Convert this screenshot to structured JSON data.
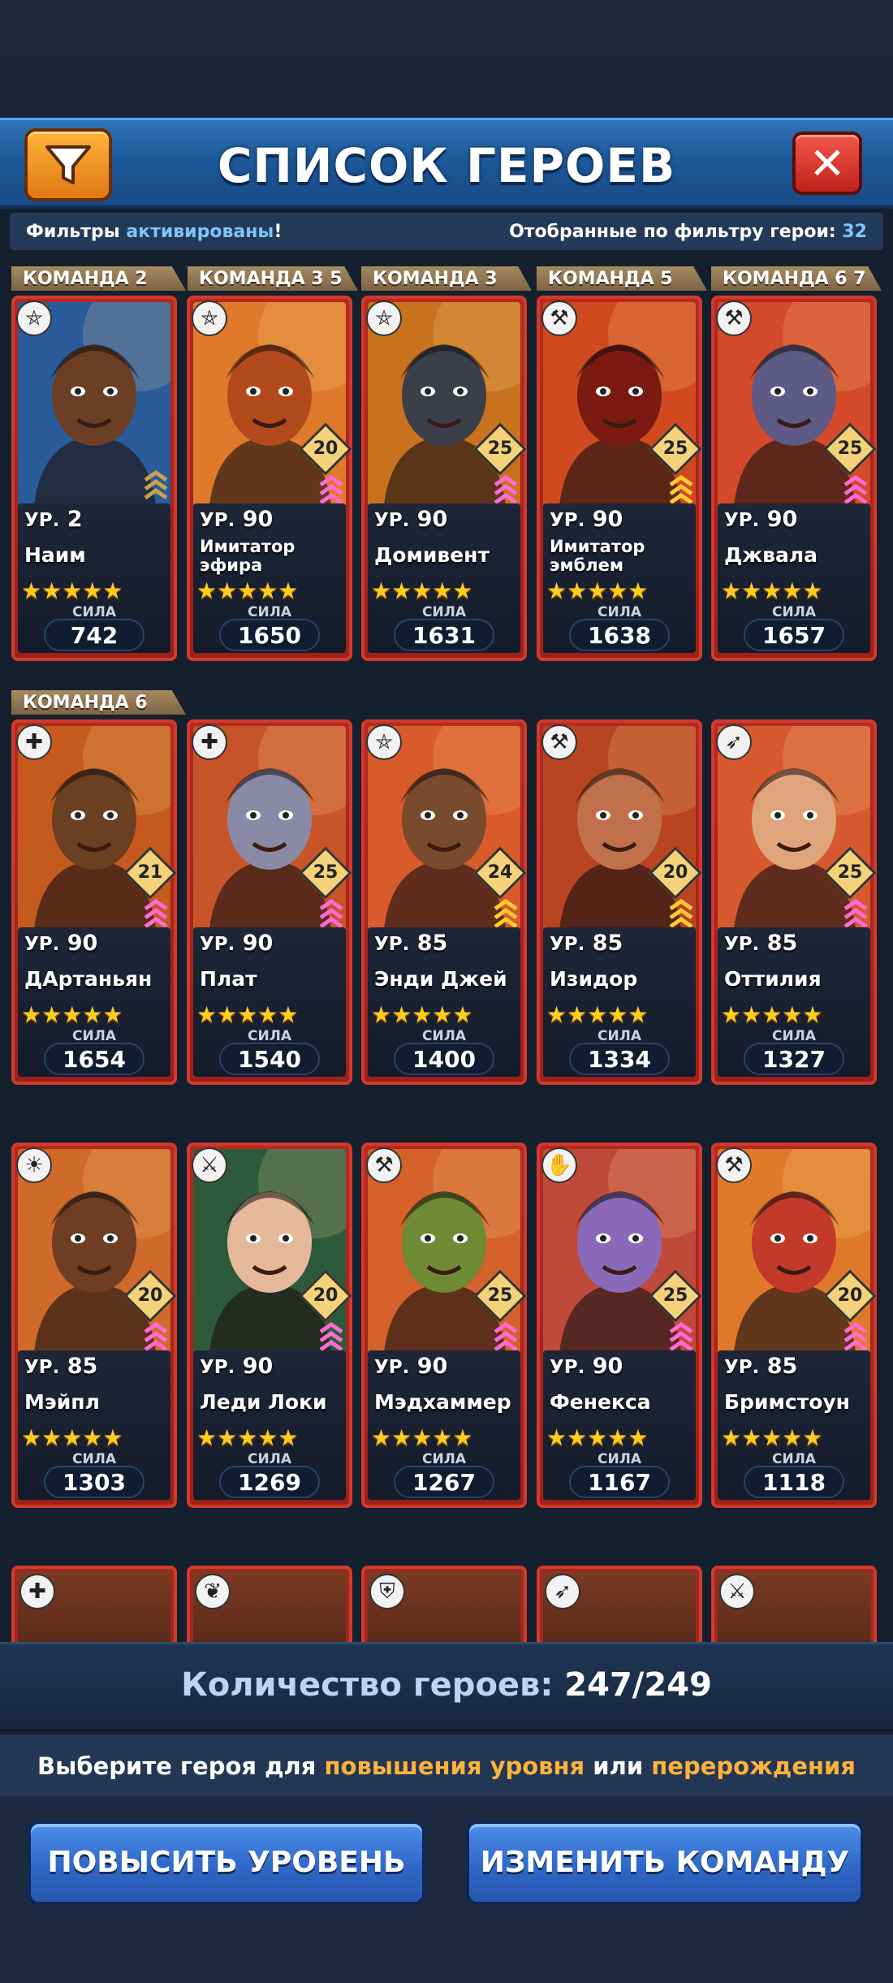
{
  "header": {
    "title": "СПИСОК ГЕРОЕВ",
    "filter_icon": "funnel-icon",
    "close_icon": "close-icon",
    "close_glyph": "✕"
  },
  "filter_bar": {
    "left_prefix": "Фильтры ",
    "left_highlight": "активированы",
    "left_suffix": "!",
    "right_label": "Отобранные по фильтру герои: ",
    "right_count": "32"
  },
  "level_prefix": "УР.",
  "power_label": "СИЛА",
  "stars": "★★★★★",
  "teams": [
    "КОМАНДА 2",
    "КОМАНДА 3 5",
    "КОМАНДА 3",
    "КОМАНДА 5",
    "КОМАНДА 6 7",
    "КОМАНДА 6"
  ],
  "heroes": [
    {
      "name": "Наим",
      "level": "2",
      "power": "742",
      "badge": "",
      "class": "wizard-hat-icon",
      "skin": "#6b3e26",
      "bg": "#2a5b9a",
      "chev": "#c8a24a"
    },
    {
      "name": "Имитатор эфира",
      "level": "90",
      "power": "1650",
      "badge": "20",
      "class": "pentagram-icon",
      "skin": "#b34a1c",
      "bg": "#e07a2a",
      "chev": "#ff6ad5"
    },
    {
      "name": "Домивент",
      "level": "90",
      "power": "1631",
      "badge": "25",
      "class": "pentagram-icon",
      "skin": "#3b3f4a",
      "bg": "#c9721e",
      "chev": "#ff6ad5"
    },
    {
      "name": "Имитатор эмблем",
      "level": "90",
      "power": "1638",
      "badge": "25",
      "class": "axe-icon",
      "skin": "#7a1a12",
      "bg": "#d14a1f",
      "chev": "#ffcc33"
    },
    {
      "name": "Джвала",
      "level": "90",
      "power": "1657",
      "badge": "25",
      "class": "axe-icon",
      "skin": "#5d5a86",
      "bg": "#d44a2a",
      "chev": "#ff6ad5"
    },
    {
      "name": "ДАртаньян",
      "level": "90",
      "power": "1654",
      "badge": "21",
      "class": "book-icon",
      "skin": "#6a3f22",
      "bg": "#c45a1e",
      "chev": "#ff6ad5"
    },
    {
      "name": "Плат",
      "level": "90",
      "power": "1540",
      "badge": "25",
      "class": "book-icon",
      "skin": "#8a8aa6",
      "bg": "#c8552a",
      "chev": "#ff6ad5"
    },
    {
      "name": "Энди Джей",
      "level": "85",
      "power": "1400",
      "badge": "24",
      "class": "pentagram-icon",
      "skin": "#7a4a2e",
      "bg": "#d95a2a",
      "chev": "#ffcc33"
    },
    {
      "name": "Изидор",
      "level": "85",
      "power": "1334",
      "badge": "20",
      "class": "axe-icon",
      "skin": "#c0704a",
      "bg": "#b8451f",
      "chev": "#ffcc33"
    },
    {
      "name": "Оттилия",
      "level": "85",
      "power": "1327",
      "badge": "25",
      "class": "bow-icon",
      "skin": "#e0a47c",
      "bg": "#d65a2e",
      "chev": "#ff6ad5"
    },
    {
      "name": "Мэйпл",
      "level": "85",
      "power": "1303",
      "badge": "20",
      "class": "sun-icon",
      "skin": "#6e3d22",
      "bg": "#d06a2a",
      "chev": "#ff6ad5"
    },
    {
      "name": "Леди Локи",
      "level": "90",
      "power": "1269",
      "badge": "20",
      "class": "swords-icon",
      "skin": "#e4b898",
      "bg": "#2e5a3c",
      "chev": "#ff6ad5"
    },
    {
      "name": "Мэдхаммер",
      "level": "90",
      "power": "1267",
      "badge": "25",
      "class": "axe-icon",
      "skin": "#6e8a32",
      "bg": "#d4622a",
      "chev": "#ff6ad5"
    },
    {
      "name": "Фенекса",
      "level": "90",
      "power": "1167",
      "badge": "25",
      "class": "hand-icon",
      "skin": "#8a6ab8",
      "bg": "#c04a3a",
      "chev": "#ff6ad5"
    },
    {
      "name": "Бримстоун",
      "level": "85",
      "power": "1118",
      "badge": "20",
      "class": "axe-icon",
      "skin": "#c43a2a",
      "bg": "#e07a2a",
      "chev": "#ff6ad5"
    }
  ],
  "partial_row_icons": [
    "book-icon",
    "leaf-icon",
    "shield-icon",
    "bow-icon",
    "swords-icon"
  ],
  "footer": {
    "count_label": "Количество героев: ",
    "count_value": "247/249",
    "hint_prefix": "Выберите героя для ",
    "hint_o1": "повышения уровня",
    "hint_mid": " или ",
    "hint_o2": "перерождения",
    "btn_level": "ПОВЫСИТЬ УРОВЕНЬ",
    "btn_team": "ИЗМЕНИТЬ КОМАНДУ"
  }
}
